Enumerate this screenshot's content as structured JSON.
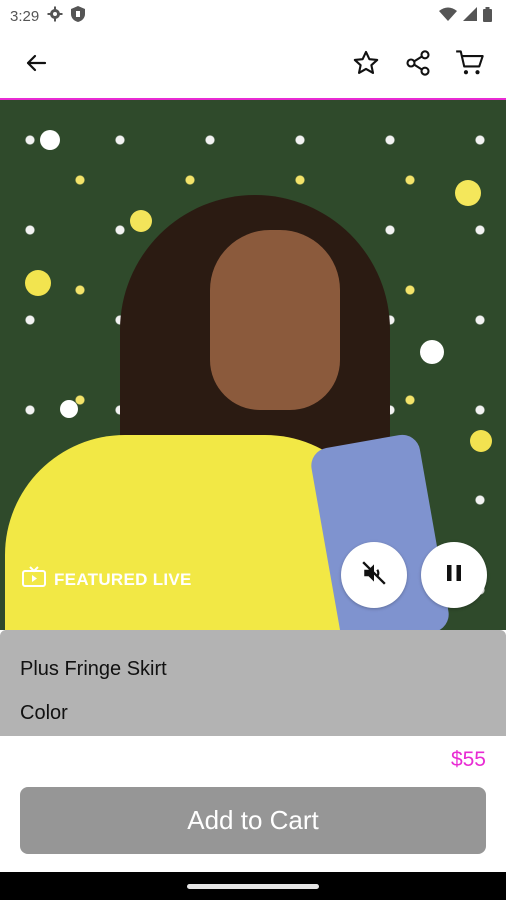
{
  "status_bar": {
    "time": "3:29",
    "icons": [
      "gear-icon",
      "shield-icon",
      "wifi-icon",
      "signal-icon",
      "battery-icon"
    ]
  },
  "app_bar": {
    "back_icon": "arrow-left-icon",
    "action_icons": [
      "star-icon",
      "share-icon",
      "cart-icon"
    ]
  },
  "colors": {
    "accent": "#e82bd3",
    "panel": "#b3b3b3",
    "button": "#969696"
  },
  "video": {
    "badge_label": "FEATURED LIVE",
    "badge_icon": "tv-icon",
    "mute_icon": "muted-speaker-icon",
    "pause_icon": "pause-icon"
  },
  "product": {
    "name": "Plus Fringe Skirt",
    "color_label": "Color",
    "price": "$55"
  },
  "actions": {
    "add_to_cart_label": "Add to Cart"
  }
}
